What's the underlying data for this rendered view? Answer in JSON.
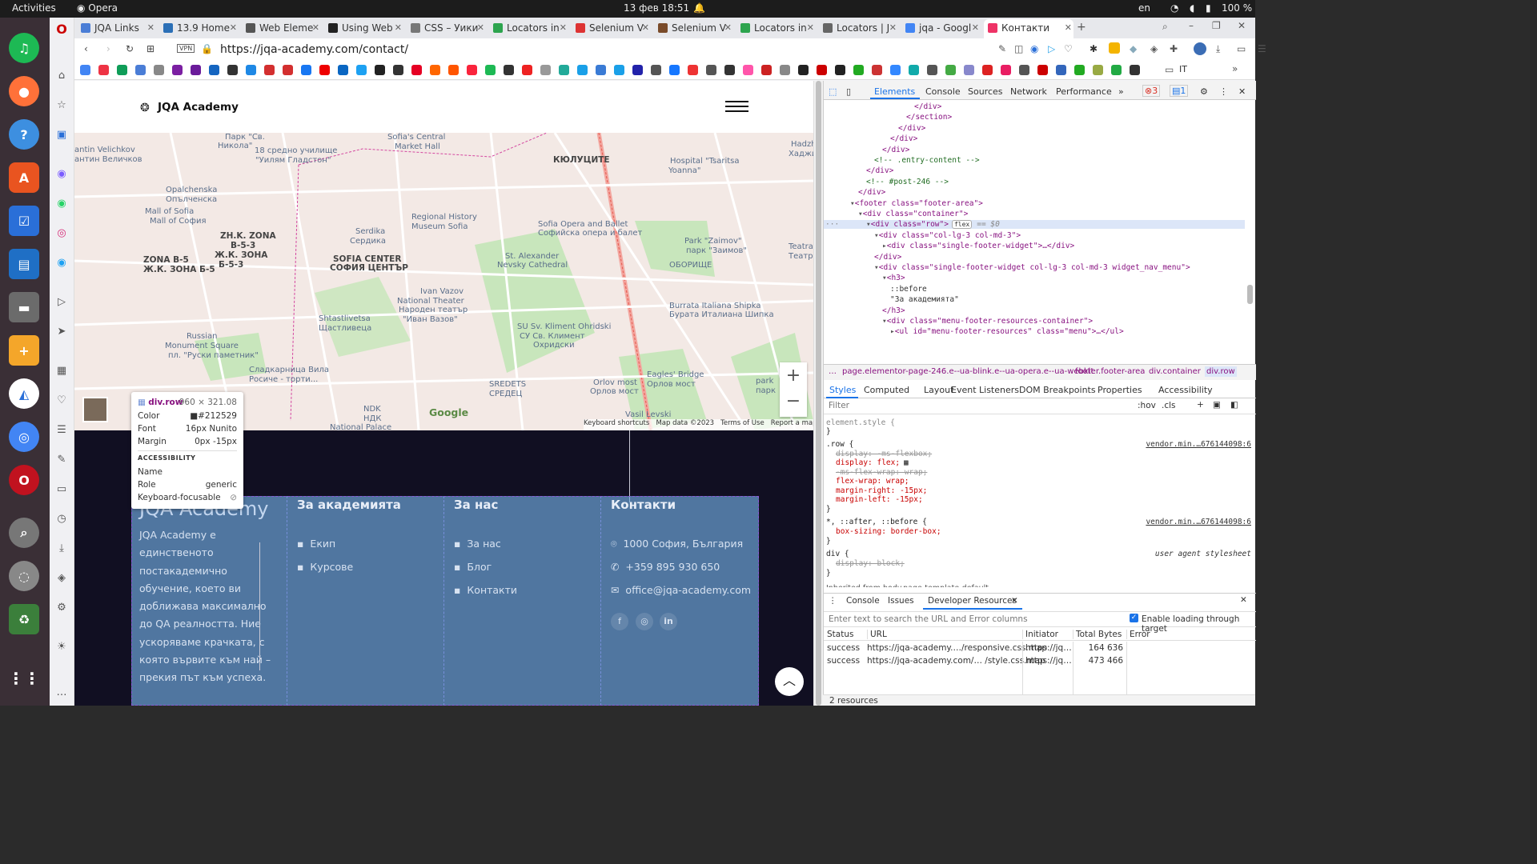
{
  "system": {
    "activities": "Activities",
    "app": "Opera",
    "clock": "13 фев  18:51",
    "lang": "en",
    "battery": "100 %"
  },
  "tabs": [
    {
      "label": "JQA Links",
      "color": "#4a7dd6"
    },
    {
      "label": "13.9 Home",
      "color": "#2b6fb6"
    },
    {
      "label": "Web Eleme",
      "color": "#555"
    },
    {
      "label": "Using Web",
      "color": "#222"
    },
    {
      "label": "CSS – Уики",
      "color": "#777"
    },
    {
      "label": "Locators in",
      "color": "#2da44e"
    },
    {
      "label": "Selenium V",
      "color": "#d33"
    },
    {
      "label": "Selenium V",
      "color": "#7a4b2a"
    },
    {
      "label": "Locators in",
      "color": "#2da44e"
    },
    {
      "label": "Locators | J",
      "color": "#666"
    },
    {
      "label": "jqa - Googl",
      "color": "#4285f4"
    },
    {
      "label": "Контакти",
      "color": "#e36"
    }
  ],
  "address": {
    "vpn": "VPN",
    "url": "https://jqa-academy.com/contact/",
    "folder": "IT"
  },
  "site": {
    "logo": "JQA Academy"
  },
  "map": {
    "labels": [
      {
        "t": "КЮЛУЦИТЕ",
        "b": 1
      },
      {
        "t": "ZH.K. ZONA",
        "b": 1
      },
      {
        "t": "B-5-3",
        "b": 1
      },
      {
        "t": "Ж.К. ЗОНА",
        "b": 1
      },
      {
        "t": "Б-5-3",
        "b": 1
      },
      {
        "t": "ZONA B-5",
        "b": 1
      },
      {
        "t": "Ж.К. ЗОНА Б-5",
        "b": 1
      },
      {
        "t": "SOFIA CENTER",
        "b": 1
      },
      {
        "t": "СОФИЯ ЦЕНТЪР",
        "b": 1
      },
      {
        "t": "Sofia's Central"
      },
      {
        "t": "Market Hall"
      },
      {
        "t": "18 средно училище"
      },
      {
        "t": "\"Уилям Гладстон\""
      },
      {
        "t": "Hospital \"Tsaritsa"
      },
      {
        "t": "Yoanna\""
      },
      {
        "t": "Opalchenska"
      },
      {
        "t": "Опълченска"
      },
      {
        "t": "Mall of Sofia"
      },
      {
        "t": "Mall of София"
      },
      {
        "t": "Serdika"
      },
      {
        "t": "Сердика"
      },
      {
        "t": "Regional History"
      },
      {
        "t": "Museum Sofia"
      },
      {
        "t": "Sofia Opera and Ballet"
      },
      {
        "t": "Софийска опера и балет"
      },
      {
        "t": "Park \"Zaimov\""
      },
      {
        "t": "парк \"Заимов\""
      },
      {
        "t": "St. Alexander"
      },
      {
        "t": "Nevsky Cathedral"
      },
      {
        "t": "Ivan Vazov"
      },
      {
        "t": "National Theater"
      },
      {
        "t": "Народен театър"
      },
      {
        "t": "\"Иван Вазов\""
      },
      {
        "t": "Shtastlivetsa"
      },
      {
        "t": "Щастливеца"
      },
      {
        "t": "SU Sv. Kliment Ohridski"
      },
      {
        "t": "СУ Св. Климент"
      },
      {
        "t": "Охридски"
      },
      {
        "t": "Burrata Italiana Shipka"
      },
      {
        "t": "Бурата Италиана Шипка"
      },
      {
        "t": "Russian"
      },
      {
        "t": "Monument Square"
      },
      {
        "t": "пл. \"Руски паметник\""
      },
      {
        "t": "Сладкарница Вила"
      },
      {
        "t": "Росиче - торти..."
      },
      {
        "t": "Orlov most"
      },
      {
        "t": "Орлов мост"
      },
      {
        "t": "Eagles' Bridge"
      },
      {
        "t": "Орлов мост"
      },
      {
        "t": "SREDETS"
      },
      {
        "t": "СРЕДЕЦ"
      },
      {
        "t": "NDK"
      },
      {
        "t": "НДК"
      },
      {
        "t": "National Palace"
      },
      {
        "t": "Vasil Levski"
      },
      {
        "t": "Парк \"Св."
      },
      {
        "t": "Никола\""
      },
      {
        "t": "antin Velichkov"
      },
      {
        "t": "антин Величков"
      },
      {
        "t": "ОБОРИЩЕ"
      },
      {
        "t": "Teatral"
      },
      {
        "t": "Театра"
      },
      {
        "t": "Hadzh"
      },
      {
        "t": "Хаджи Д"
      },
      {
        "t": "park"
      },
      {
        "t": "парк"
      }
    ],
    "zoom_in": "+",
    "zoom_out": "−",
    "google": "Google",
    "attrib": [
      "Keyboard shortcuts",
      "Map data ©2023",
      "Terms of Use",
      "Report a map error"
    ]
  },
  "footer": {
    "about_title": "JQA Academy",
    "about_text": "JQA Academy е единственото постакадемично обучение, което ви доближава максимално до QA реалността. Ние ускоряваме крачката, с която вървите към най – прекия път към успеха.",
    "col2_title": "За академията",
    "col2_items": [
      "Екип",
      "Курсове"
    ],
    "col3_title": "За нас",
    "col3_items": [
      "За нас",
      "Блог",
      "Контакти"
    ],
    "col4_title": "Контакти",
    "address": "1000 София, България",
    "phone": "+359 895 930 650",
    "email": "office@jqa-academy.com"
  },
  "tooltip": {
    "tag": "div.row",
    "size": "960 × 321.08",
    "color_label": "Color",
    "color": "#212529",
    "font_label": "Font",
    "font": "16px Nunito",
    "margin_label": "Margin",
    "margin": "0px -15px",
    "acc_title": "ACCESSIBILITY",
    "name_label": "Name",
    "role_label": "Role",
    "role": "generic",
    "kb_label": "Keyboard-focusable"
  },
  "devtools": {
    "tabs": [
      "Elements",
      "Console",
      "Sources",
      "Network",
      "Performance"
    ],
    "errors": "3",
    "messages": "1",
    "dom": [
      "</div>",
      "</section>",
      "</div>",
      "</div>",
      "</div>",
      "<!-- .entry-content -->",
      "</div>",
      "<!-- #post-246 -->",
      "</div>",
      "<footer class=\"footer-area\">",
      "<div class=\"container\">",
      "<div class=\"row\">",
      "<div class=\"col-lg-3 col-md-3\">",
      "<div class=\"single-footer-widget\">…</div>",
      "</div>",
      "<div class=\"single-footer-widget col-lg-3 col-md-3 widget_nav_menu\">",
      "<h3>",
      "::before",
      "\"За академията\"",
      "</h3>",
      "<div class=\"menu-footer-resources-container\">",
      "<ul id=\"menu-footer-resources\" class=\"menu\">…</ul>"
    ],
    "flex_badge": "flex",
    "dollar": "== $0",
    "crumbs": [
      "…",
      "page.elementor-page-246.e--ua-blink.e--ua-opera.e--ua-webkit",
      "footer.footer-area",
      "div.container",
      "div.row"
    ],
    "style_tabs": [
      "Styles",
      "Computed",
      "Layout",
      "Event Listeners",
      "DOM Breakpoints",
      "Properties",
      "Accessibility"
    ],
    "filter": "Filter",
    "hov": ":hov",
    ".cls": ".cls",
    "styles": [
      "element.style {",
      "}",
      ".row {",
      "display: -ms-flexbox;",
      "display: flex;",
      "-ms-flex-wrap: wrap;",
      "flex-wrap: wrap;",
      "margin-right: -15px;",
      "margin-left: -15px;",
      "}",
      "*, ::after, ::before {",
      "box-sizing: border-box;",
      "}",
      "div {",
      "display: block;",
      "}",
      "Inherited from body.page-template-default..."
    ],
    "src1": "vendor.min.…676144098:6",
    "src2": "vendor.min.…676144098:6",
    "ua": "user agent stylesheet",
    "drawer_tabs": [
      "Console",
      "Issues",
      "Developer Resources"
    ],
    "search_ph": "Enter text to search the URL and Error columns",
    "enable": "Enable loading through target",
    "cols": [
      "Status",
      "URL",
      "Initiator",
      "Total Bytes",
      "Error"
    ],
    "rows": [
      {
        "status": "success",
        "url": "https://jqa-academy.…/responsive.css.map",
        "init": "https://jq…",
        "bytes": "164 636"
      },
      {
        "status": "success",
        "url": "https://jqa-academy.com/… /style.css.map",
        "init": "https://jq…",
        "bytes": "473 466"
      }
    ],
    "count": "2 resources"
  }
}
